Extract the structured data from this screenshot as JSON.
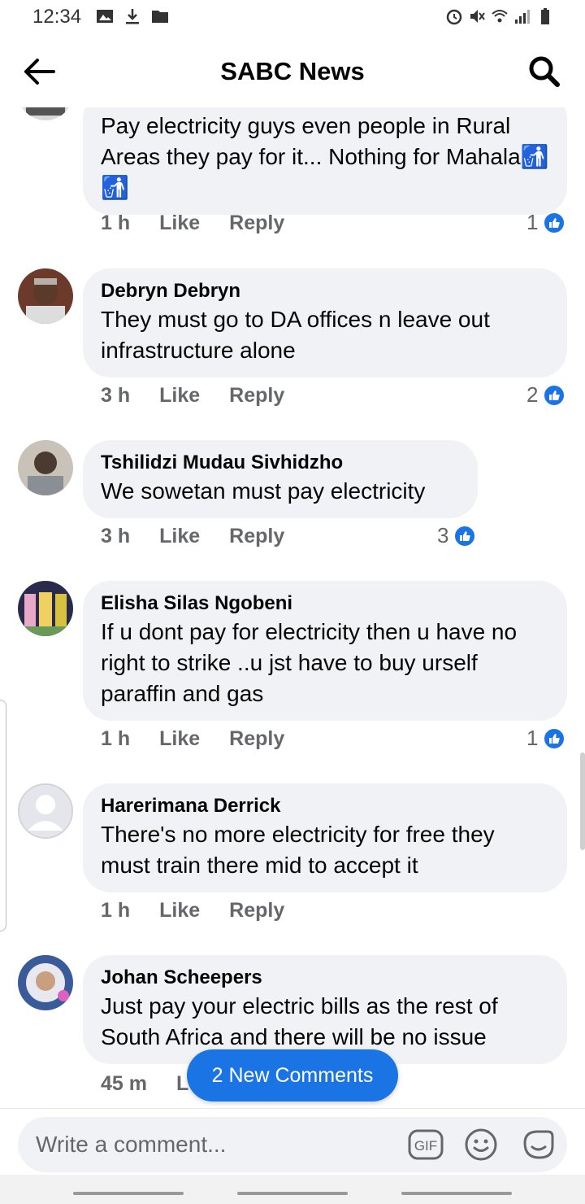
{
  "status_bar": {
    "time": "12:34",
    "left_icons": [
      "image-icon",
      "download-icon",
      "folder-icon"
    ],
    "right_icons": [
      "alarm-icon",
      "mute-icon",
      "wifi-icon",
      "signal-icon",
      "battery-icon"
    ]
  },
  "header": {
    "title": "SABC News"
  },
  "comments": [
    {
      "author": "",
      "text": "Pay electricity guys even people in Rural Areas they pay for it... Nothing for Mahala🚮🚮",
      "time": "1 h",
      "like_label": "Like",
      "reply_label": "Reply",
      "reaction_count": "1"
    },
    {
      "author": "Debryn Debryn",
      "text": "They must go to DA offices n leave out infrastructure alone",
      "time": "3 h",
      "like_label": "Like",
      "reply_label": "Reply",
      "reaction_count": "2"
    },
    {
      "author": "Tshilidzi Mudau Sivhidzho",
      "text": "We sowetan must pay electricity",
      "time": "3 h",
      "like_label": "Like",
      "reply_label": "Reply",
      "reaction_count": "3"
    },
    {
      "author": "Elisha Silas Ngobeni",
      "text": "If u dont pay for electricity then u have no right to strike ..u jst have to buy urself paraffin and gas",
      "time": "1 h",
      "like_label": "Like",
      "reply_label": "Reply",
      "reaction_count": "1"
    },
    {
      "author": "Harerimana Derrick",
      "text": "There's no more electricity for free they must train there mid to accept it",
      "time": "1 h",
      "like_label": "Like",
      "reply_label": "Reply",
      "reaction_count": ""
    },
    {
      "author": "Johan Scheepers",
      "text": "Just pay your electric bills as the rest of South Africa and there will be no issue",
      "time": "45 m",
      "like_label": "L",
      "reply_label": "",
      "reaction_count": ""
    }
  ],
  "new_comments_pill": "2 New Comments",
  "composer": {
    "placeholder": "Write a comment...",
    "gif_label": "GIF"
  },
  "colors": {
    "accent": "#1b74e4",
    "bubble": "#f0f2f5",
    "secondary_text": "#65676b"
  }
}
